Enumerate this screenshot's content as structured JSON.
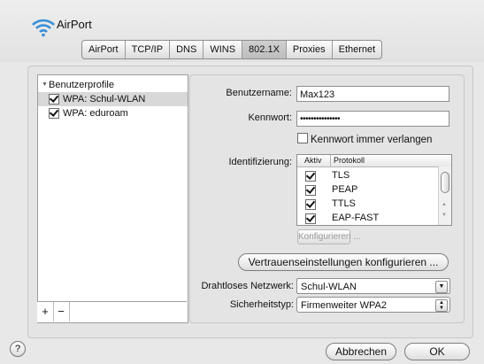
{
  "header": {
    "title": "AirPort"
  },
  "tabs": [
    {
      "label": "AirPort"
    },
    {
      "label": "TCP/IP"
    },
    {
      "label": "DNS"
    },
    {
      "label": "WINS"
    },
    {
      "label": "802.1X"
    },
    {
      "label": "Proxies"
    },
    {
      "label": "Ethernet"
    }
  ],
  "selected_tab": "802.1X",
  "profiles": {
    "group_label": "Benutzerprofile",
    "items": [
      {
        "label": "WPA: Schul-WLAN",
        "checked": true,
        "selected": true
      },
      {
        "label": "WPA: eduroam",
        "checked": true,
        "selected": false
      }
    ],
    "add_label": "+",
    "remove_label": "−"
  },
  "form": {
    "username_label": "Benutzername:",
    "username_value": "Max123",
    "password_label": "Kennwort:",
    "password_value": "•••••••••••••••",
    "always_ask_label": "Kennwort immer verlangen",
    "ident_label": "Identifizierung:",
    "table_headers": {
      "active": "Aktiv",
      "protocol": "Protokoll"
    },
    "protocols": [
      {
        "name": "TLS",
        "active": true
      },
      {
        "name": "PEAP",
        "active": true
      },
      {
        "name": "TTLS",
        "active": true
      },
      {
        "name": "EAP-FAST",
        "active": true
      }
    ],
    "configure_label": "Konfigurieren ...",
    "trust_label": "Vertrauenseinstellungen konfigurieren ...",
    "network_label": "Drahtloses Netzwerk:",
    "network_value": "Schul-WLAN",
    "security_label": "Sicherheitstyp:",
    "security_value": "Firmenweiter WPA2"
  },
  "footer": {
    "help_label": "?",
    "cancel_label": "Abbrechen",
    "ok_label": "OK"
  },
  "colors": {
    "wifi_blue": "#3a8fd6"
  }
}
